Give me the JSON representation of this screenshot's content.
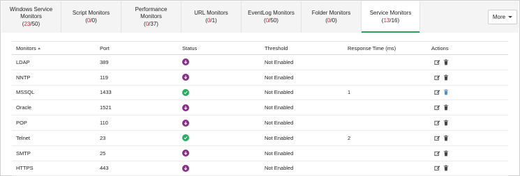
{
  "tabs": [
    {
      "label": "Windows Service Monitors",
      "up": "23",
      "total": "50",
      "active": false
    },
    {
      "label": "Script Monitors",
      "up": "0",
      "total": "0",
      "active": false
    },
    {
      "label": "Performance Monitors",
      "up": "0",
      "total": "37",
      "active": false
    },
    {
      "label": "URL Monitors",
      "up": "0",
      "total": "1",
      "active": false
    },
    {
      "label": "EventLog Monitors",
      "up": "0",
      "total": "50",
      "active": false
    },
    {
      "label": "Folder Monitors",
      "up": "0",
      "total": "0",
      "active": false
    },
    {
      "label": "Service Monitors",
      "up": "13",
      "total": "16",
      "active": true
    }
  ],
  "more_button": {
    "label": "More",
    "icon": "caret-down-icon"
  },
  "table": {
    "headers": {
      "monitors": "Monitors",
      "port": "Port",
      "status": "Status",
      "threshold": "Threshold",
      "response": "Response Time (ms)",
      "actions": "Actions"
    },
    "rows": [
      {
        "name": "LDAP",
        "port": "389",
        "status": "down",
        "threshold": "Not Enabled",
        "response": ""
      },
      {
        "name": "NNTP",
        "port": "119",
        "status": "down",
        "threshold": "Not Enabled",
        "response": ""
      },
      {
        "name": "MSSQL",
        "port": "1433",
        "status": "up",
        "threshold": "Not Enabled",
        "response": "1"
      },
      {
        "name": "Oracle",
        "port": "1521",
        "status": "down",
        "threshold": "Not Enabled",
        "response": ""
      },
      {
        "name": "POP",
        "port": "110",
        "status": "down",
        "threshold": "Not Enabled",
        "response": ""
      },
      {
        "name": "Telnet",
        "port": "23",
        "status": "up",
        "threshold": "Not Enabled",
        "response": "2"
      },
      {
        "name": "SMTP",
        "port": "25",
        "status": "down",
        "threshold": "Not Enabled",
        "response": ""
      },
      {
        "name": "HTTPS",
        "port": "443",
        "status": "down",
        "threshold": "Not Enabled",
        "response": ""
      }
    ]
  },
  "colors": {
    "accent_green": "#2e9e5b",
    "count_red": "#d9232e",
    "status_down": "#8a2b8c",
    "status_up": "#27ae60",
    "highlight_delete": "#4a90d9"
  }
}
